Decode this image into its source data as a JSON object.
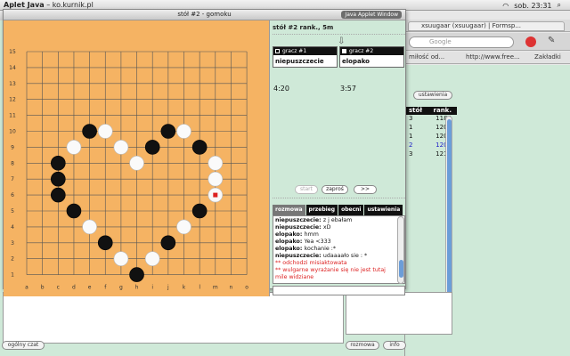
{
  "menubar": {
    "app_name": "Aplet Java",
    "window_title": "ko.kurnik.pl",
    "clock": "sob. 23:31"
  },
  "browser": {
    "tab_title": "xsuugaar (xsuugaar) | Formsp...",
    "search_placeholder": "Google",
    "bookmark_1": "miłość od...",
    "bookmark_2": "http://www.free...",
    "bookmark_3": "Zakładki"
  },
  "outer": {
    "settings_button": "ustawienia",
    "general_chat_button": "ogólny czat",
    "chat_button": "rozmowa",
    "info_button": "info",
    "rank_table": {
      "headers": [
        "stół",
        "rank."
      ],
      "rows": [
        {
          "table": "3",
          "rank": "1184",
          "color": "#111111"
        },
        {
          "table": "1",
          "rank": "1200",
          "color": "#111111"
        },
        {
          "table": "1",
          "rank": "1200",
          "color": "#111111"
        },
        {
          "table": "2",
          "rank": "1200",
          "color": "#1c1cc8"
        },
        {
          "table": "3",
          "rank": "1216",
          "color": "#111111"
        }
      ]
    }
  },
  "applet": {
    "title": "stół #2 - gomoku",
    "badge": "Java Applet Window",
    "header": "stół #2    rank., 5m",
    "player1": {
      "label": "gracz #1",
      "name": "niepuszczecie",
      "time": "4:20",
      "stone": "black"
    },
    "player2": {
      "label": "gracz #2",
      "name": "elopako",
      "time": "3:57",
      "stone": "white"
    },
    "buttons": {
      "start": "start",
      "invite": "zaproś",
      "more": ">>"
    },
    "chat_tabs": [
      "rozmowa",
      "przebieg",
      "obecni",
      "ustawienia"
    ],
    "chat": [
      {
        "nick": "niepuszczecie:",
        "text": "z j ebałam"
      },
      {
        "nick": "niepuszczecie:",
        "text": "xD"
      },
      {
        "nick": "elopako:",
        "text": "hmm"
      },
      {
        "nick": "elopako:",
        "text": "Yea <333"
      },
      {
        "nick": "elopako:",
        "text": "kochanie :*"
      },
      {
        "nick": "niepuszczecie:",
        "text": "udaaaało sie : *"
      },
      {
        "system": "** odchodzi misiaktowata"
      },
      {
        "system": "** wulgarne wyrażanie się nie jest tutaj mile widziane"
      }
    ]
  },
  "board": {
    "columns": [
      "a",
      "b",
      "c",
      "d",
      "e",
      "f",
      "g",
      "h",
      "i",
      "j",
      "k",
      "l",
      "m",
      "n",
      "o"
    ],
    "rows": [
      "15",
      "14",
      "13",
      "12",
      "11",
      "10",
      "9",
      "8",
      "7",
      "6",
      "5",
      "4",
      "3",
      "2",
      "1"
    ],
    "colors": {
      "background": "#f5b363",
      "grid": "#555555",
      "last_move": "#dd2222"
    },
    "stones": [
      {
        "col": "e",
        "row": 10,
        "color": "black"
      },
      {
        "col": "f",
        "row": 10,
        "color": "white"
      },
      {
        "col": "j",
        "row": 10,
        "color": "black"
      },
      {
        "col": "k",
        "row": 10,
        "color": "white"
      },
      {
        "col": "d",
        "row": 9,
        "color": "white"
      },
      {
        "col": "g",
        "row": 9,
        "color": "white"
      },
      {
        "col": "i",
        "row": 9,
        "color": "black"
      },
      {
        "col": "l",
        "row": 9,
        "color": "black"
      },
      {
        "col": "c",
        "row": 8,
        "color": "black"
      },
      {
        "col": "h",
        "row": 8,
        "color": "white"
      },
      {
        "col": "m",
        "row": 8,
        "color": "white"
      },
      {
        "col": "c",
        "row": 7,
        "color": "black"
      },
      {
        "col": "m",
        "row": 7,
        "color": "white"
      },
      {
        "col": "c",
        "row": 6,
        "color": "black"
      },
      {
        "col": "m",
        "row": 6,
        "color": "white",
        "last": true
      },
      {
        "col": "d",
        "row": 5,
        "color": "black"
      },
      {
        "col": "l",
        "row": 5,
        "color": "black"
      },
      {
        "col": "e",
        "row": 4,
        "color": "white"
      },
      {
        "col": "k",
        "row": 4,
        "color": "white"
      },
      {
        "col": "f",
        "row": 3,
        "color": "black"
      },
      {
        "col": "j",
        "row": 3,
        "color": "black"
      },
      {
        "col": "g",
        "row": 2,
        "color": "white"
      },
      {
        "col": "i",
        "row": 2,
        "color": "white"
      },
      {
        "col": "h",
        "row": 1,
        "color": "black"
      }
    ]
  }
}
